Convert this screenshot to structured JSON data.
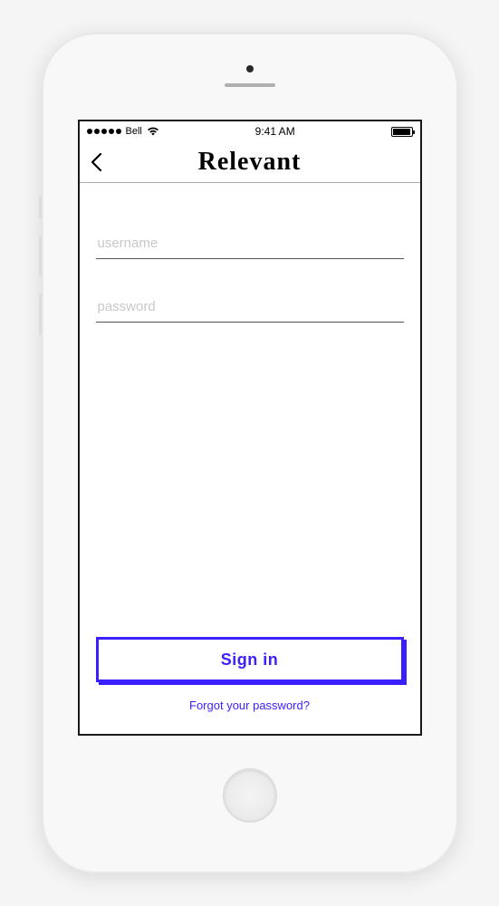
{
  "status_bar": {
    "carrier": "Bell",
    "time": "9:41 AM"
  },
  "header": {
    "title": "Relevant"
  },
  "form": {
    "username_placeholder": "username",
    "password_placeholder": "password"
  },
  "actions": {
    "signin_label": "Sign in",
    "forgot_label": "Forgot your password?"
  },
  "colors": {
    "accent": "#3a1fff"
  }
}
